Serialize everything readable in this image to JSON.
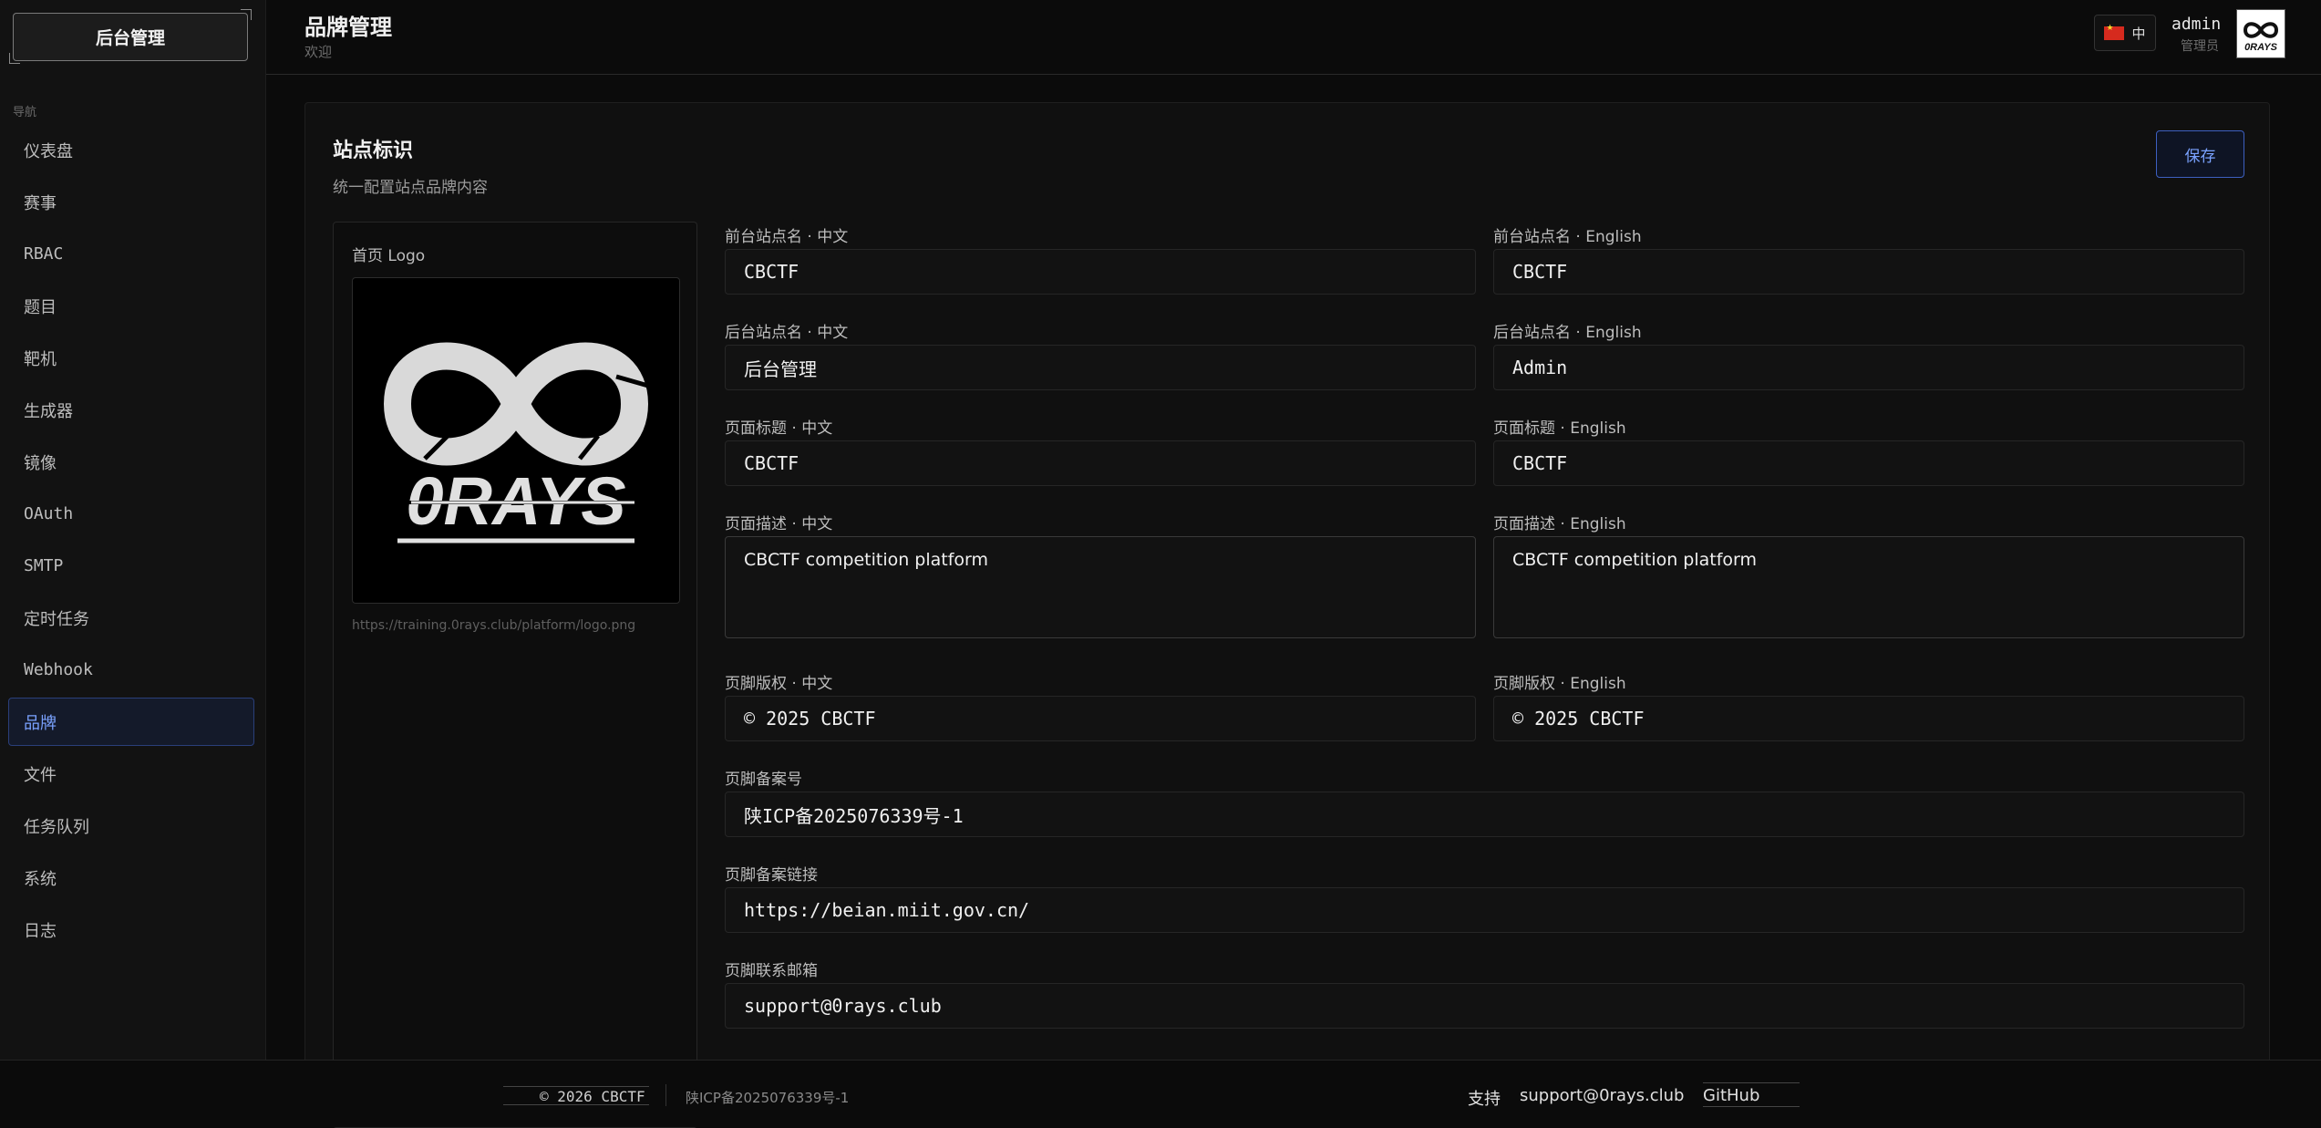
{
  "sidebar": {
    "brand": "后台管理",
    "nav_title": "导航",
    "items": [
      {
        "label": "仪表盘"
      },
      {
        "label": "赛事"
      },
      {
        "label": "RBAC"
      },
      {
        "label": "题目"
      },
      {
        "label": "靶机"
      },
      {
        "label": "生成器"
      },
      {
        "label": "镜像"
      },
      {
        "label": "OAuth"
      },
      {
        "label": "SMTP"
      },
      {
        "label": "定时任务"
      },
      {
        "label": "Webhook"
      },
      {
        "label": "品牌"
      },
      {
        "label": "文件"
      },
      {
        "label": "任务队列"
      },
      {
        "label": "系统"
      },
      {
        "label": "日志"
      }
    ],
    "active": "品牌"
  },
  "header": {
    "title": "品牌管理",
    "subtitle": "欢迎",
    "lang": "中",
    "user_name": "admin",
    "user_role": "管理员"
  },
  "card": {
    "title": "站点标识",
    "desc": "统一配置站点品牌内容",
    "save_label": "保存",
    "logo_label": "首页 Logo",
    "logo_text": "0RAYS",
    "logo_url": "https://training.0rays.club/platform/logo.png"
  },
  "fields": {
    "front_zh_label": "前台站点名 · 中文",
    "front_zh": "CBCTF",
    "front_en_label": "前台站点名 · English",
    "front_en": "CBCTF",
    "admin_zh_label": "后台站点名 · 中文",
    "admin_zh": "后台管理",
    "admin_en_label": "后台站点名 · English",
    "admin_en": "Admin",
    "title_zh_label": "页面标题 · 中文",
    "title_zh": "CBCTF",
    "title_en_label": "页面标题 · English",
    "title_en": "CBCTF",
    "desc_zh_label": "页面描述 · 中文",
    "desc_zh": "CBCTF competition platform",
    "desc_en_label": "页面描述 · English",
    "desc_en": "CBCTF competition platform",
    "copy_zh_label": "页脚版权 · 中文",
    "copy_zh": "© 2025 CBCTF",
    "copy_en_label": "页脚版权 · English",
    "copy_en": "© 2025 CBCTF",
    "icp_label": "页脚备案号",
    "icp": "陕ICP备2025076339号-1",
    "icp_link_label": "页脚备案链接",
    "icp_link": "https://beian.miit.gov.cn/",
    "email_label": "页脚联系邮箱",
    "email": "support@0rays.club"
  },
  "footer": {
    "copyright": "© 2026 CBCTF",
    "icp": "陕ICP备2025076339号-1",
    "support": "支持",
    "email": "support@0rays.club",
    "github": "GitHub"
  }
}
